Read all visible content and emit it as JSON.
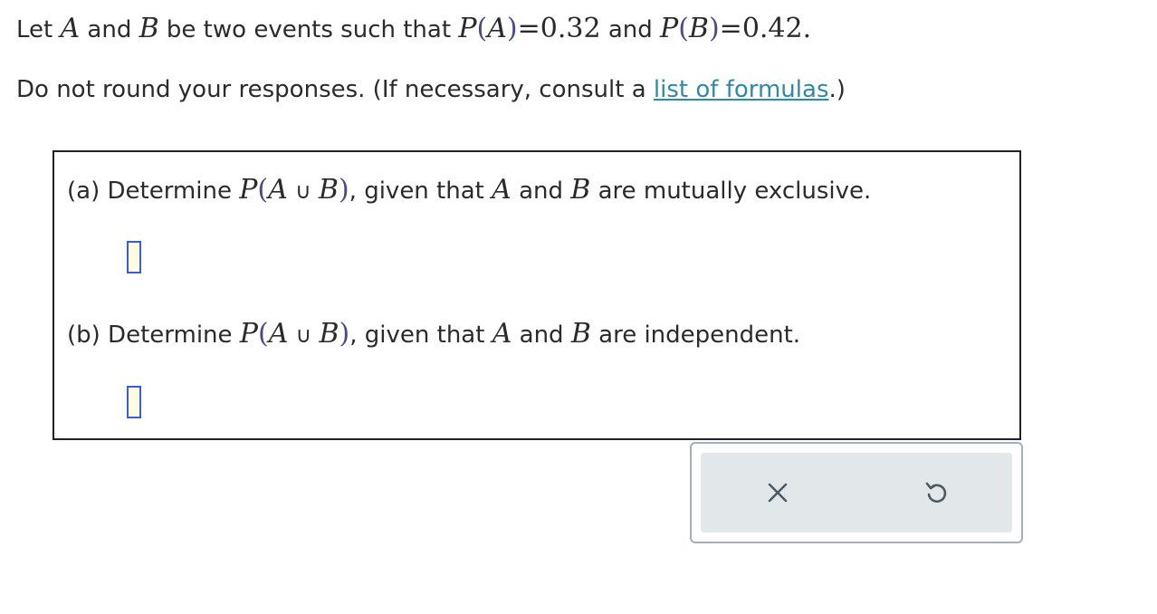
{
  "problem": {
    "intro_let": "Let",
    "var_a": "A",
    "intro_and": "and",
    "var_b": "B",
    "intro_rest": "be two events such that",
    "p_symbol": "P",
    "p_a_value": "0.32",
    "p_b_value": "0.42",
    "period": ".",
    "instruction": "Do not round your responses. (If necessary, consult a",
    "link_text": "list of formulas",
    "instruction_end": ".)"
  },
  "parts": {
    "a": {
      "label": "(a) Determine",
      "union_symbol": "∪",
      "condition": ", given that",
      "condition_and": "and",
      "condition_end": "are mutually exclusive.",
      "answer": ""
    },
    "b": {
      "label": "(b) Determine",
      "union_symbol": "∪",
      "condition": ", given that",
      "condition_and": "and",
      "condition_end": "are independent.",
      "answer": ""
    }
  },
  "toolbar": {
    "clear_icon": "close-icon",
    "undo_icon": "undo-icon"
  },
  "colors": {
    "link": "#2f8aa8",
    "input_border": "#3b5bdb",
    "input_fill": "#fffbe0",
    "toolbar_bg": "#e2e7ea",
    "icon": "#4a5b66"
  }
}
